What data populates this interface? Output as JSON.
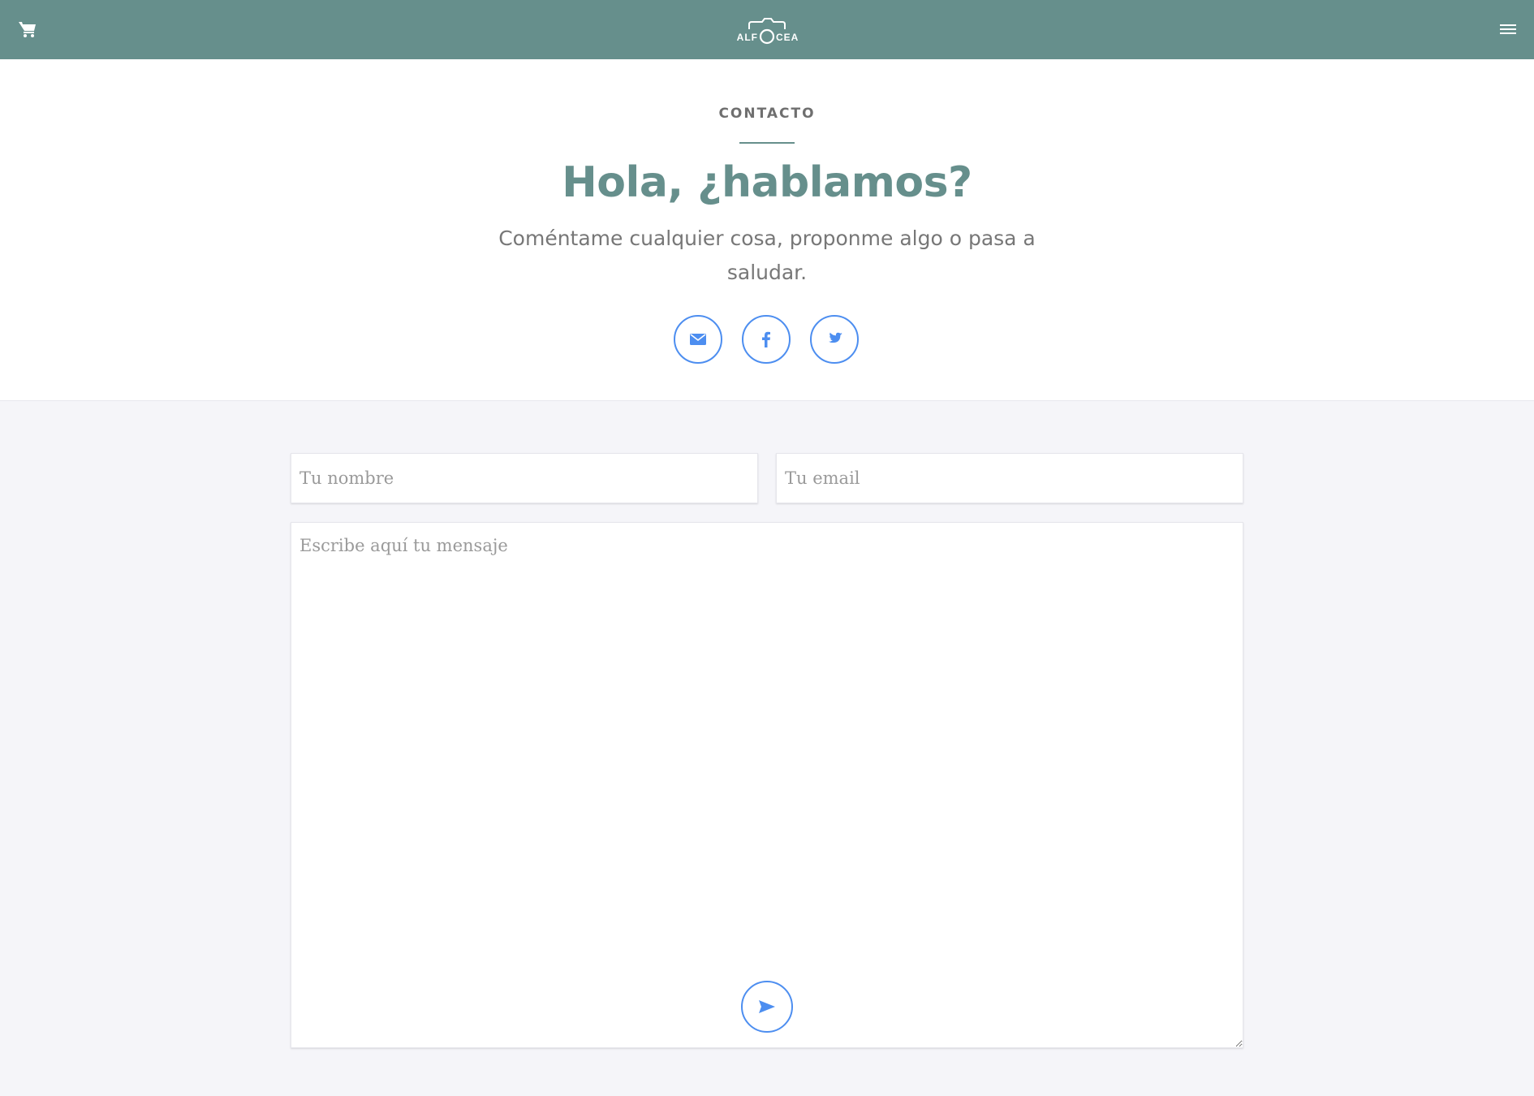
{
  "header": {
    "logo_text": "ALFOCEA",
    "cart_icon": "cart-icon",
    "menu_icon": "hamburger-menu-icon",
    "background_color": "#668f8c"
  },
  "hero": {
    "eyebrow": "CONTACTO",
    "title": "Hola, ¿hablamos?",
    "subtitle": "Coméntame cualquier cosa, proponme algo o pasa a saludar.",
    "social_links": [
      {
        "icon": "mail-icon"
      },
      {
        "icon": "facebook-icon"
      },
      {
        "icon": "twitter-icon"
      }
    ],
    "accent_color": "#668f8c",
    "link_color": "#4d8ef0"
  },
  "form": {
    "name_placeholder": "Tu nombre",
    "name_value": "",
    "email_placeholder": "Tu email",
    "email_value": "",
    "message_placeholder": "Escribe aquí tu mensaje",
    "message_value": "",
    "send_icon": "send-icon"
  }
}
